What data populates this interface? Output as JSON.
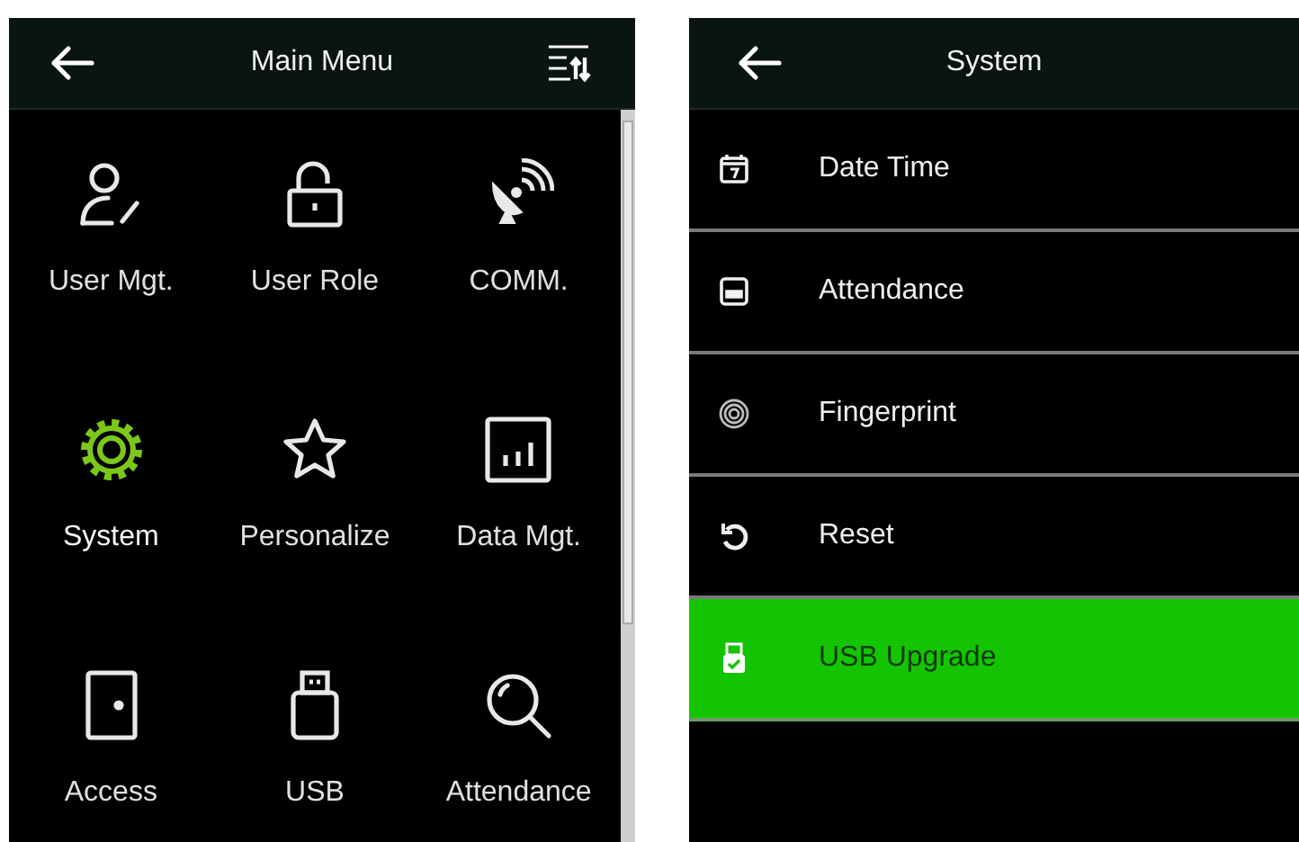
{
  "main_menu": {
    "title": "Main Menu",
    "items": [
      {
        "label": "User Mgt.",
        "kind": "user",
        "selected": false
      },
      {
        "label": "User Role",
        "kind": "lock",
        "selected": false
      },
      {
        "label": "COMM.",
        "kind": "satellite",
        "selected": false
      },
      {
        "label": "System",
        "kind": "gear",
        "selected": true
      },
      {
        "label": "Personalize",
        "kind": "star",
        "selected": false
      },
      {
        "label": "Data Mgt.",
        "kind": "chart",
        "selected": false
      },
      {
        "label": "Access",
        "kind": "door",
        "selected": false
      },
      {
        "label": "USB",
        "kind": "usb",
        "selected": false
      },
      {
        "label": "Attendance",
        "kind": "search",
        "selected": false
      }
    ]
  },
  "system_menu": {
    "title": "System",
    "items": [
      {
        "label": "Date Time",
        "kind": "calendar",
        "selected": false
      },
      {
        "label": "Attendance",
        "kind": "attendance",
        "selected": false
      },
      {
        "label": "Fingerprint",
        "kind": "fingerprint",
        "selected": false
      },
      {
        "label": "Reset",
        "kind": "reset",
        "selected": false
      },
      {
        "label": "USB Upgrade",
        "kind": "usb-upgrade",
        "selected": true
      }
    ]
  }
}
